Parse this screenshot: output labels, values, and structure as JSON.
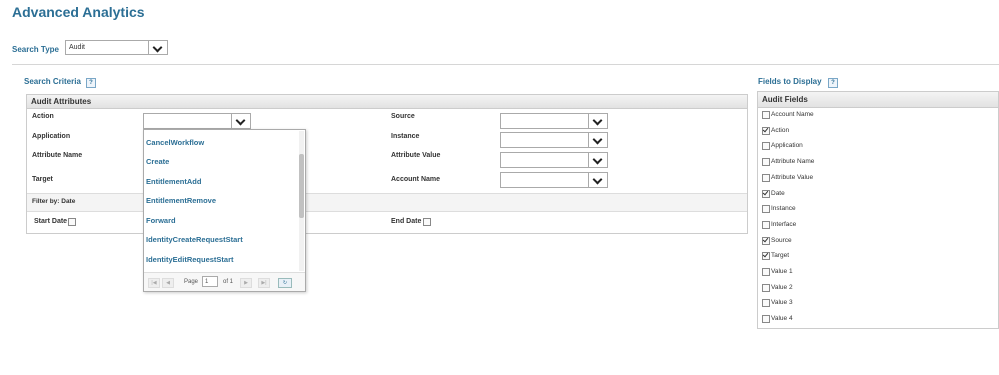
{
  "page_title": "Advanced Analytics",
  "search_type": {
    "label": "Search Type",
    "value": "Audit"
  },
  "search_criteria": {
    "label": "Search Criteria",
    "help": "?",
    "panel_title": "Audit Attributes",
    "fields": {
      "action": "Action",
      "application": "Application",
      "attribute_name": "Attribute Name",
      "target": "Target",
      "source": "Source",
      "instance": "Instance",
      "attribute_value": "Attribute Value",
      "account_name": "Account Name"
    },
    "filter_label": "Filter by: Date",
    "start_date": "Start Date",
    "end_date": "End Date"
  },
  "action_dropdown": {
    "options": [
      "CancelWorkflow",
      "Create",
      "EntitlementAdd",
      "EntitlementRemove",
      "Forward",
      "IdentityCreateRequestStart",
      "IdentityEditRequestStart"
    ],
    "pager": {
      "page_label": "Page",
      "page_value": "1",
      "of_label": "of 1",
      "first": "|◀",
      "prev": "◀",
      "next": "▶",
      "last": "▶|",
      "refresh": "↻"
    }
  },
  "fields_to_display": {
    "label": "Fields to Display",
    "help": "?",
    "panel_title": "Audit Fields",
    "items": [
      {
        "label": "Account Name",
        "checked": false
      },
      {
        "label": "Action",
        "checked": true
      },
      {
        "label": "Application",
        "checked": false
      },
      {
        "label": "Attribute Name",
        "checked": false
      },
      {
        "label": "Attribute Value",
        "checked": false
      },
      {
        "label": "Date",
        "checked": true
      },
      {
        "label": "Instance",
        "checked": false
      },
      {
        "label": "Interface",
        "checked": false
      },
      {
        "label": "Source",
        "checked": true
      },
      {
        "label": "Target",
        "checked": true
      },
      {
        "label": "Value 1",
        "checked": false
      },
      {
        "label": "Value 2",
        "checked": false
      },
      {
        "label": "Value 3",
        "checked": false
      },
      {
        "label": "Value 4",
        "checked": false
      }
    ]
  }
}
